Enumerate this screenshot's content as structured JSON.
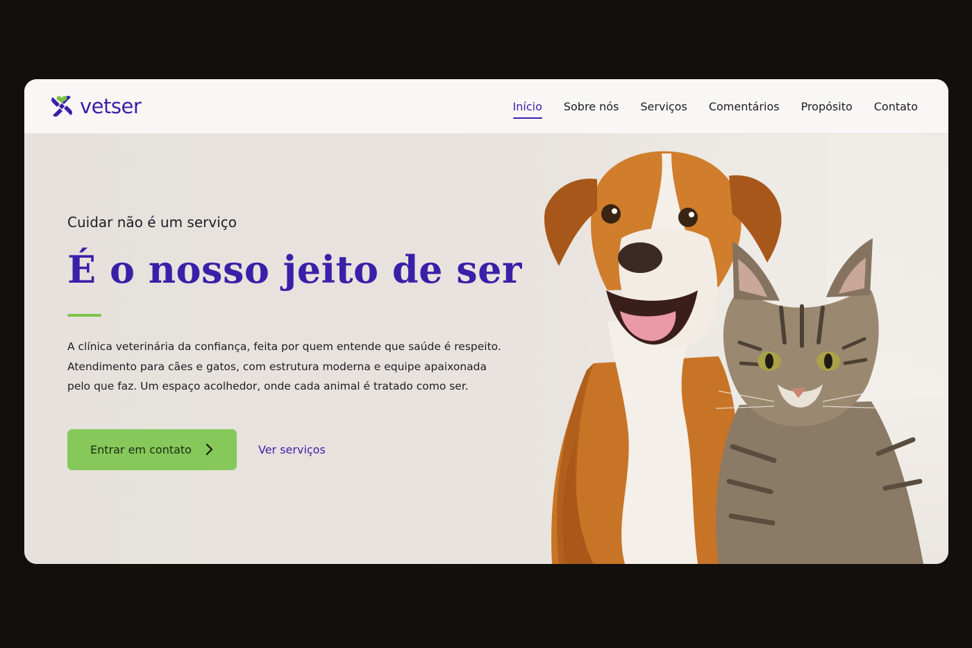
{
  "brand": {
    "name": "vetser",
    "accent": "#3a1fa8",
    "green": "#7cc248"
  },
  "nav": {
    "items": [
      {
        "label": "Início",
        "active": true
      },
      {
        "label": "Sobre nós",
        "active": false
      },
      {
        "label": "Serviços",
        "active": false
      },
      {
        "label": "Comentários",
        "active": false
      },
      {
        "label": "Propósito",
        "active": false
      },
      {
        "label": "Contato",
        "active": false
      }
    ]
  },
  "hero": {
    "eyebrow": "Cuidar não é um serviço",
    "headline": "É o nosso jeito de ser",
    "body": "A clínica veterinária da confiança, feita por quem entende que saúde é respeito. Atendimento para cães e gatos, com estrutura moderna e equipe apaixonada pelo que faz. Um espaço acolhedor, onde cada animal é tratado como ser.",
    "primary_cta": "Entrar em contato",
    "primary_cta_icon": "chevron-right-icon",
    "secondary_cta": "Ver serviços"
  }
}
